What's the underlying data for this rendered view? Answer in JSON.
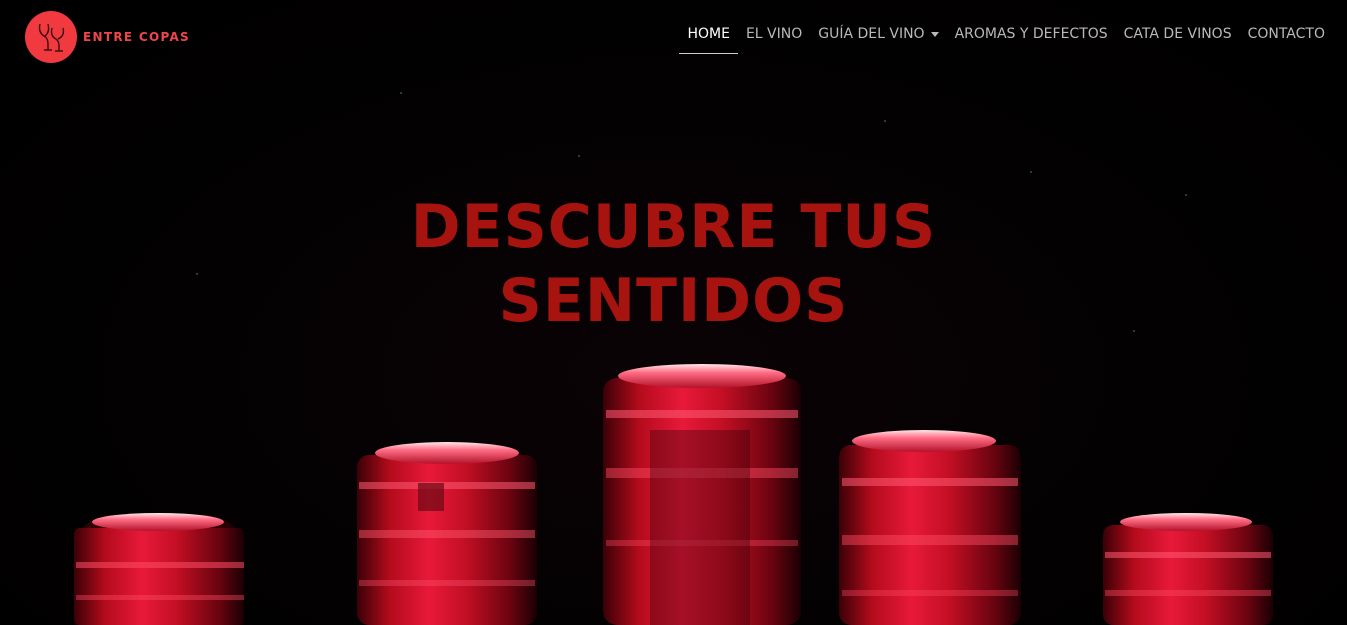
{
  "brand": {
    "name": "ENTRE COPAS",
    "logo_color": "#f13a3f"
  },
  "nav": {
    "items": [
      {
        "label": "HOME",
        "active": true
      },
      {
        "label": "EL VINO",
        "active": false
      },
      {
        "label": "GUÍA DEL VINO",
        "active": false,
        "dropdown": true
      },
      {
        "label": "AROMAS Y DEFECTOS",
        "active": false
      },
      {
        "label": "CATA DE VINOS",
        "active": false
      },
      {
        "label": "CONTACTO",
        "active": false
      }
    ]
  },
  "hero": {
    "title_line1": "DESCUBRE TUS",
    "title_line2": "SENTIDOS",
    "title_color": "#a7140f",
    "image": "wine-bottle-tops"
  },
  "colors": {
    "background": "#000000",
    "accent": "#f13a3f",
    "nav_text": "#b9b9b9",
    "nav_active": "#ffffff"
  }
}
